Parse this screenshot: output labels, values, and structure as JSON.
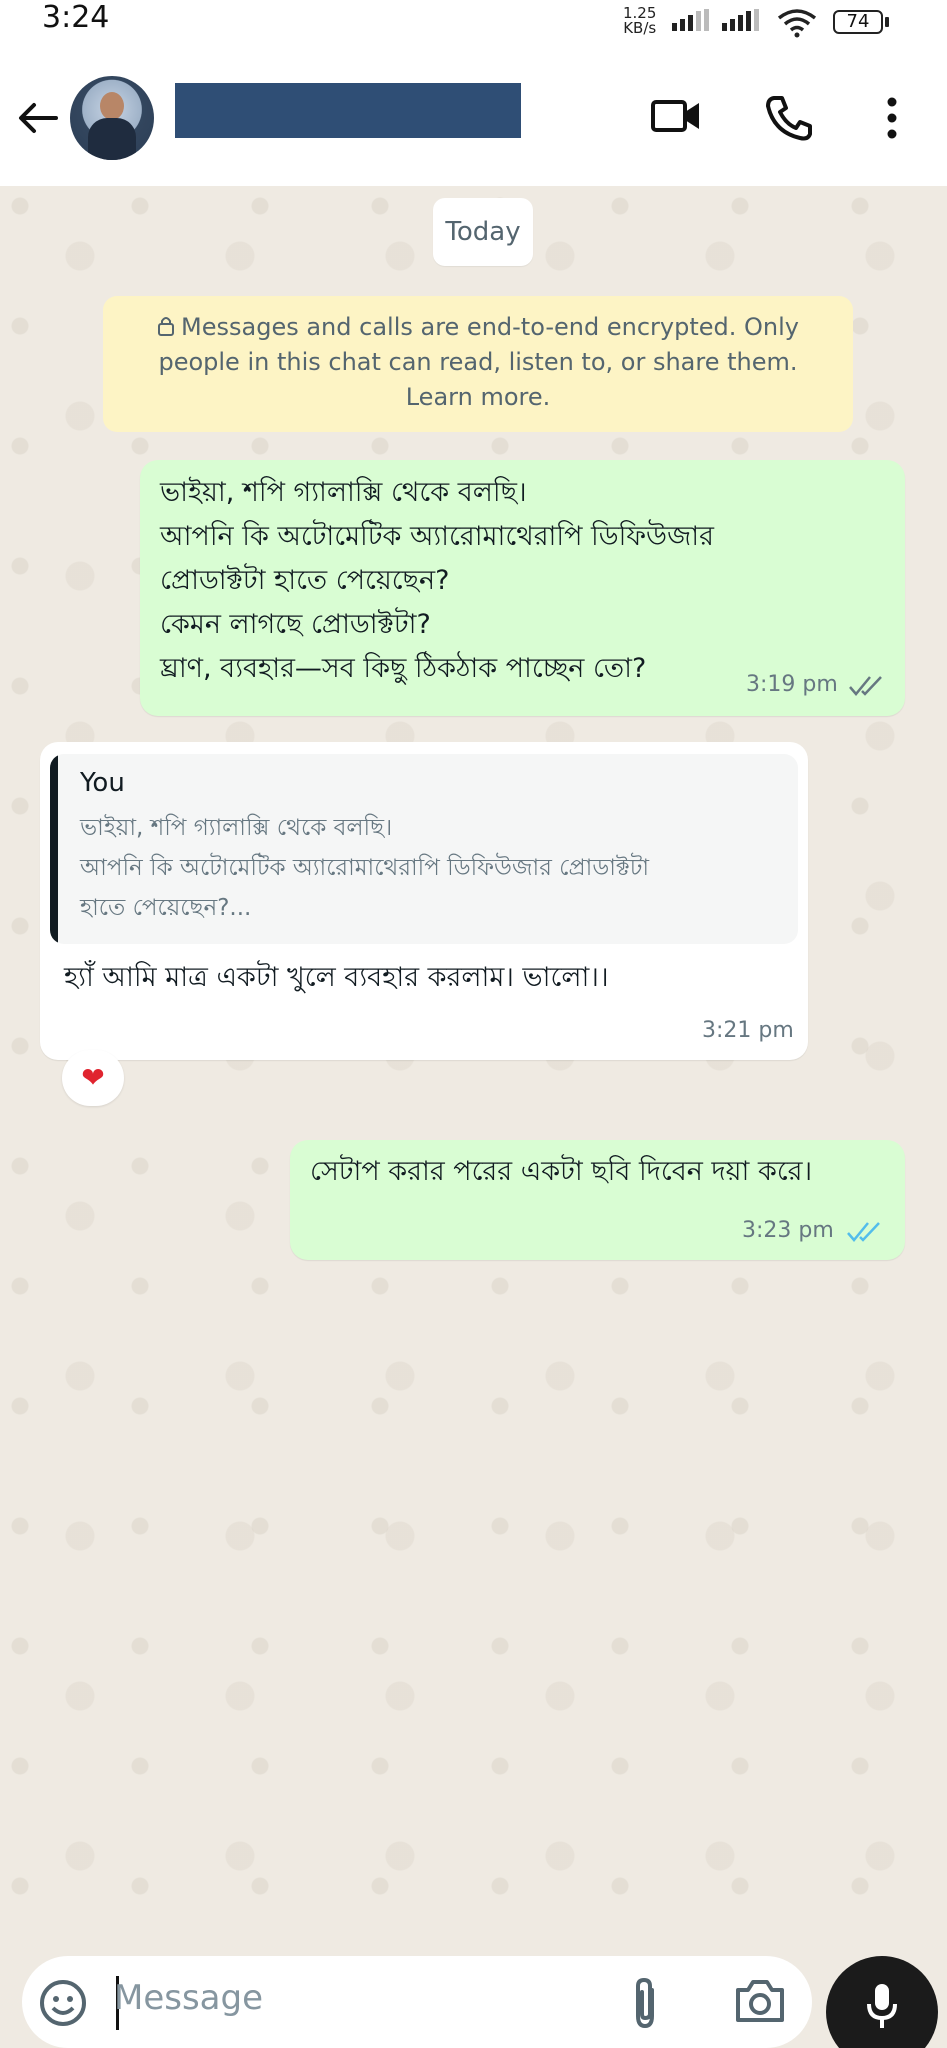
{
  "status_bar": {
    "time": "3:24",
    "net_speed_value": "1.25",
    "net_speed_unit": "KB/s",
    "battery": "74"
  },
  "header": {
    "icons": [
      "back-arrow-icon",
      "video-call-icon",
      "phone-icon",
      "more-vertical-icon"
    ]
  },
  "chat": {
    "date_chip": "Today",
    "encryption_notice": "Messages and calls are end-to-end encrypted. Only people in this chat can read, listen to, or share them. Learn more.",
    "messages": [
      {
        "direction": "outgoing",
        "text": "ভাইয়া, শপি গ্যালাক্সি থেকে বলছি।\nআপনি কি অটোমেটিক অ্যারোমাথেরাপি ডিফিউজার\nপ্রোডাক্টটা হাতে পেয়েছেন?\nকেমন লাগছে প্রোডাক্টটা?\nঘ্রাণ, ব্যবহার—সব কিছু ঠিকঠাক পাচ্ছেন তো?",
        "time": "3:19 pm",
        "status": "delivered"
      },
      {
        "direction": "incoming",
        "quote_author": "You",
        "quote_text": "ভাইয়া, শপি গ্যালাক্সি থেকে বলছি।\nআপনি কি অটোমেটিক অ্যারোমাথেরাপি ডিফিউজার প্রোডাক্টটা\nহাতে পেয়েছেন?...",
        "text": "হ্যাঁ আমি মাত্র একটা খুলে ব্যবহার করলাম। ভালো।।",
        "time": "3:21 pm",
        "reaction": "❤"
      },
      {
        "direction": "outgoing",
        "text": "সেটাপ করার পরের একটা ছবি দিবেন দয়া করে।",
        "time": "3:23 pm",
        "status": "read"
      }
    ]
  },
  "input": {
    "placeholder": "Message",
    "icons": [
      "sticker-icon",
      "attach-icon",
      "camera-icon",
      "mic-icon"
    ]
  },
  "colors": {
    "outgoing_bubble": "#d9fdd3",
    "incoming_bubble": "#ffffff",
    "read_ticks": "#53bdeb",
    "delivered_ticks": "#667781",
    "contact_name_block": "#2f4e75"
  }
}
